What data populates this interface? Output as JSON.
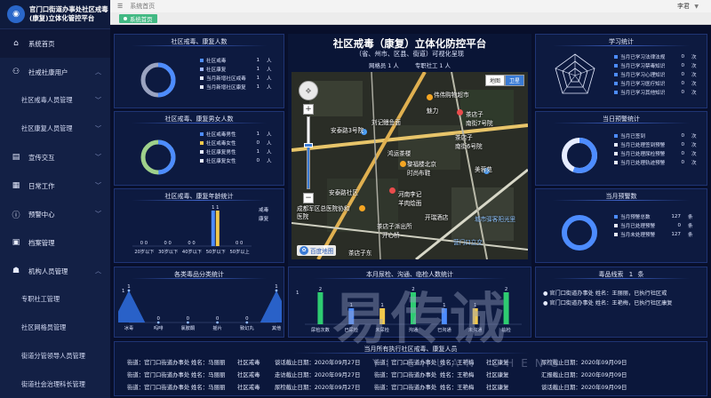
{
  "app": {
    "title_line1": "官门口街道办事处社区戒毒",
    "title_line2": "(康复)立体化管控平台"
  },
  "sidebar": {
    "items": [
      {
        "label": "系统首页",
        "icon": "home-icon"
      },
      {
        "label": "社戒社康用户",
        "icon": "users-icon"
      },
      {
        "label": "社区戒毒人员管理"
      },
      {
        "label": "社区康复人员管理"
      },
      {
        "label": "宣传交互",
        "icon": "megaphone-icon"
      },
      {
        "label": "日常工作",
        "icon": "calendar-icon"
      },
      {
        "label": "预警中心",
        "icon": "alert-icon"
      },
      {
        "label": "档案管理",
        "icon": "archive-icon"
      },
      {
        "label": "机构人员管理",
        "icon": "person-icon"
      },
      {
        "label": "专职社工管理"
      },
      {
        "label": "社区网格员管理"
      },
      {
        "label": "街道分管领导人员管理"
      },
      {
        "label": "街道社会治理科长管理"
      }
    ]
  },
  "topbar": {
    "breadcrumb": "系统首页",
    "user": "李君"
  },
  "tabs": {
    "home": "系统首页"
  },
  "panels": {
    "community": {
      "title": "社区戒毒、康复人数",
      "donut_fraction": 0.5,
      "colors": [
        "#4d8cff",
        "#9aa3c0"
      ],
      "rows": [
        {
          "label": "社区戒毒",
          "value": "1",
          "unit": "人",
          "color": "#4d8cff"
        },
        {
          "label": "社区康复",
          "value": "1",
          "unit": "人",
          "color": "#9fb6ff"
        },
        {
          "label": "当月新增社区戒毒",
          "value": "1",
          "unit": "人",
          "color": "#e6ecff"
        },
        {
          "label": "当月新增社区康复",
          "value": "1",
          "unit": "人",
          "color": "#e6ecff"
        }
      ]
    },
    "gender": {
      "title": "社区戒毒、康复男女人数",
      "rows": [
        {
          "label": "社区戒毒男性",
          "value": "1",
          "unit": "人",
          "color": "#4d8cff"
        },
        {
          "label": "社区戒毒女性",
          "value": "0",
          "unit": "人",
          "color": "#f2c94c"
        },
        {
          "label": "社区康复男性",
          "value": "1",
          "unit": "人",
          "color": "#e6ecff"
        },
        {
          "label": "社区康复女性",
          "value": "0",
          "unit": "人",
          "color": "#e6ecff"
        }
      ]
    },
    "age": {
      "title": "社区戒毒、康复年龄统计",
      "legend": [
        "戒毒",
        "康复"
      ]
    },
    "study": {
      "title": "学习统计",
      "rows": [
        {
          "label": "当月已学习法律法规",
          "value": "0",
          "unit": "次"
        },
        {
          "label": "当月已学习禁毒知识",
          "value": "0",
          "unit": "次"
        },
        {
          "label": "当月已学习心理知识",
          "value": "0",
          "unit": "次"
        },
        {
          "label": "当月已学习医疗知识",
          "value": "0",
          "unit": "次"
        },
        {
          "label": "当月已学习其他知识",
          "value": "0",
          "unit": "次"
        }
      ]
    },
    "month_warning_stats": {
      "title": "当日预警统计",
      "rows": [
        {
          "label": "当月已签到",
          "value": "0",
          "unit": "次"
        },
        {
          "label": "当月已处理签到预警",
          "value": "0",
          "unit": "次"
        },
        {
          "label": "当月已处理尿检预警",
          "value": "0",
          "unit": "次"
        },
        {
          "label": "当月已处理轨迹预警",
          "value": "0",
          "unit": "次"
        }
      ]
    },
    "month_warning_count": {
      "title": "当月预警数",
      "rows": [
        {
          "label": "当月预警总数",
          "value": "127",
          "unit": "条"
        },
        {
          "label": "当月已处理预警",
          "value": "0",
          "unit": "条"
        },
        {
          "label": "当月未处理预警",
          "value": "127",
          "unit": "条"
        }
      ]
    },
    "drug_type": {
      "title": "各类毒品分类统计",
      "ytop": "1"
    },
    "checks": {
      "title": "本月尿检、沟通、临检人数统计",
      "ytop": "1"
    },
    "clues": {
      "title": "毒品线索",
      "count": "1",
      "unit": "条",
      "items": [
        "官门口街道办事处    姓名：王丽丽，已执行社区戒",
        "官门口街道办事处    姓名：王艳梅，已执行社区康复"
      ]
    }
  },
  "center": {
    "title": "社区戒毒（康复）立体化防控平台",
    "subtitle": "（省、州市、区县、街道）可视化呈现",
    "staff": [
      "网格员 1 人",
      "专职社工 1 人"
    ],
    "map_types": [
      "地图",
      "卫星"
    ],
    "map_labels": [
      "伟伟购物超市",
      "魅力",
      "安泰路3号院",
      "刘记鳗鱼面",
      "茶店子",
      "南街7号院",
      "茶店子",
      "南街6号院",
      "鸿运茶楼",
      "黎福楼北京",
      "时尚布鞋",
      "美蓉苑",
      "河南李记",
      "羊肉烩面",
      "安泰路社区",
      "成都军区总医院协和医院",
      "茶店子派出所",
      "开心桥",
      "开瑞酒店",
      "城市驿客阳光里",
      "营门口立交",
      "茶店子东"
    ],
    "map_logo": "百度地图"
  },
  "chart_data": [
    {
      "type": "bar",
      "title": "社区戒毒、康复年龄统计",
      "categories": [
        "20岁以下",
        "30岁以下",
        "40岁以下",
        "50岁以下",
        "50岁以上"
      ],
      "series": [
        {
          "name": "戒毒",
          "values": [
            0,
            0,
            0,
            1,
            0
          ],
          "color": "#4d8cff"
        },
        {
          "name": "康复",
          "values": [
            0,
            0,
            0,
            1,
            0
          ],
          "color": "#f2c94c"
        }
      ],
      "ylim": [
        0,
        1
      ]
    },
    {
      "type": "area",
      "title": "各类毒品分类统计",
      "categories": [
        "冰毒",
        "吗啡",
        "氯胺酮",
        "摇片",
        "致幻丸",
        "其他"
      ],
      "values": [
        1,
        0,
        0,
        0,
        0,
        1
      ],
      "ylim": [
        0,
        1
      ]
    },
    {
      "type": "bar",
      "title": "本月尿检、沟通、临检人数统计",
      "categories": [
        "尿检次数",
        "已尿检",
        "未尿检",
        "沟通",
        "已沟通",
        "未沟通",
        "临检"
      ],
      "values": [
        2,
        1,
        1,
        2,
        1,
        1,
        2
      ],
      "colors": [
        "#2ecc71",
        "#4d8cff",
        "#f2c94c",
        "#2ecc71",
        "#4d8cff",
        "#f2c94c",
        "#2ecc71"
      ],
      "ylim": [
        0,
        2
      ]
    }
  ],
  "recent": {
    "title": "当月所有执行社区戒毒、康复人员",
    "rows": [
      [
        "街道：官门口街道办事处",
        "姓名：马丽丽",
        "社区戒毒",
        "谈话截止日期：2020年09月27日",
        "街道：官门口街道办事处",
        "姓名：王艳梅",
        "社区康复",
        "尿检截止日期：2020年09月09日"
      ],
      [
        "街道：官门口街道办事处",
        "姓名：马丽丽",
        "社区戒毒",
        "走访截止日期：2020年09月27日",
        "街道：官门口街道办事处",
        "姓名：王艳梅",
        "社区康复",
        "汇报截止日期：2020年09月09日"
      ],
      [
        "街道：官门口街道办事处",
        "姓名：马丽丽",
        "社区戒毒",
        "尿检截止日期：2020年09月27日",
        "街道：官门口街道办事处",
        "姓名：王艳梅",
        "社区康复",
        "谈话截止日期：2020年09月09日"
      ]
    ]
  },
  "watermark": {
    "mark": "易传诚",
    "sub": "YI CHUAN CHENG"
  }
}
